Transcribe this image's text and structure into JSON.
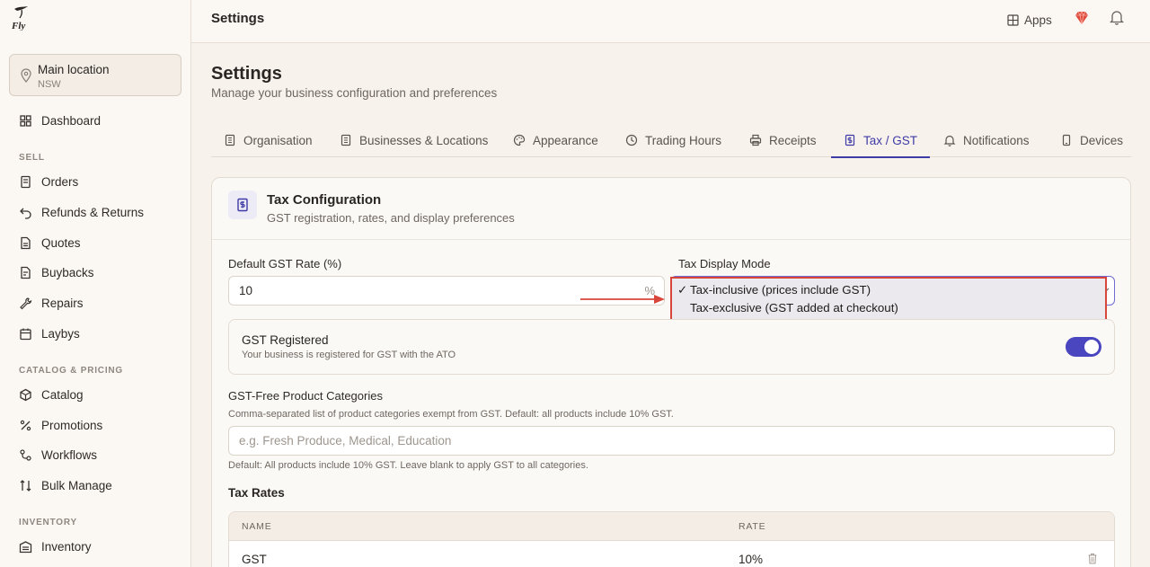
{
  "app": {
    "logo_text": "Fly"
  },
  "location": {
    "name": "Main location",
    "region": "NSW"
  },
  "sidebar": {
    "items": [
      {
        "label": "Dashboard",
        "icon": "dashboard-icon"
      },
      {
        "label": "Orders",
        "icon": "orders-icon"
      },
      {
        "label": "Refunds & Returns",
        "icon": "refund-icon"
      },
      {
        "label": "Quotes",
        "icon": "quotes-icon"
      },
      {
        "label": "Buybacks",
        "icon": "buybacks-icon"
      },
      {
        "label": "Repairs",
        "icon": "wrench-icon"
      },
      {
        "label": "Laybys",
        "icon": "calendar-icon"
      },
      {
        "label": "Catalog",
        "icon": "box-icon"
      },
      {
        "label": "Promotions",
        "icon": "percent-icon"
      },
      {
        "label": "Workflows",
        "icon": "workflow-icon"
      },
      {
        "label": "Bulk Manage",
        "icon": "bulk-icon"
      },
      {
        "label": "Inventory",
        "icon": "warehouse-icon"
      }
    ],
    "sections": {
      "sell": "SELL",
      "catalog": "CATALOG & PRICING",
      "inventory": "INVENTORY"
    }
  },
  "topbar": {
    "title": "Settings",
    "apps_label": "Apps"
  },
  "page": {
    "title": "Settings",
    "subtitle": "Manage your business configuration and preferences"
  },
  "tabs": [
    {
      "label": "Organisation"
    },
    {
      "label": "Businesses & Locations"
    },
    {
      "label": "Appearance"
    },
    {
      "label": "Trading Hours"
    },
    {
      "label": "Receipts"
    },
    {
      "label": "Tax / GST"
    },
    {
      "label": "Notifications"
    },
    {
      "label": "Devices"
    }
  ],
  "active_tab": "Tax / GST",
  "tax_card": {
    "title": "Tax Configuration",
    "subtitle": "GST registration, rates, and display preferences",
    "gst_rate_label": "Default GST Rate (%)",
    "gst_rate_value": "10",
    "gst_rate_suffix": "%",
    "display_mode_label": "Tax Display Mode",
    "display_mode_options": [
      "Tax-inclusive (prices include GST)",
      "Tax-exclusive (GST added at checkout)"
    ],
    "display_mode_selected": "Tax-inclusive (prices include GST)",
    "check_mark": "✓",
    "gst_registered_title": "GST Registered",
    "gst_registered_desc": "Your business is registered for GST with the ATO",
    "gst_registered_on": true,
    "gst_free_label": "GST-Free Product Categories",
    "gst_free_help": "Comma-separated list of product categories exempt from GST. Default: all products include 10% GST.",
    "gst_free_placeholder": "e.g. Fresh Produce, Medical, Education",
    "gst_free_footer": "Default: All products include 10% GST. Leave blank to apply GST to all categories.",
    "tax_rates_title": "Tax Rates",
    "table": {
      "columns": [
        "NAME",
        "RATE"
      ],
      "rows": [
        {
          "name": "GST",
          "rate": "10%"
        }
      ]
    }
  },
  "colors": {
    "accent": "#3e3aa6",
    "highlight": "#d8453a",
    "toggle": "#4a46c0"
  }
}
